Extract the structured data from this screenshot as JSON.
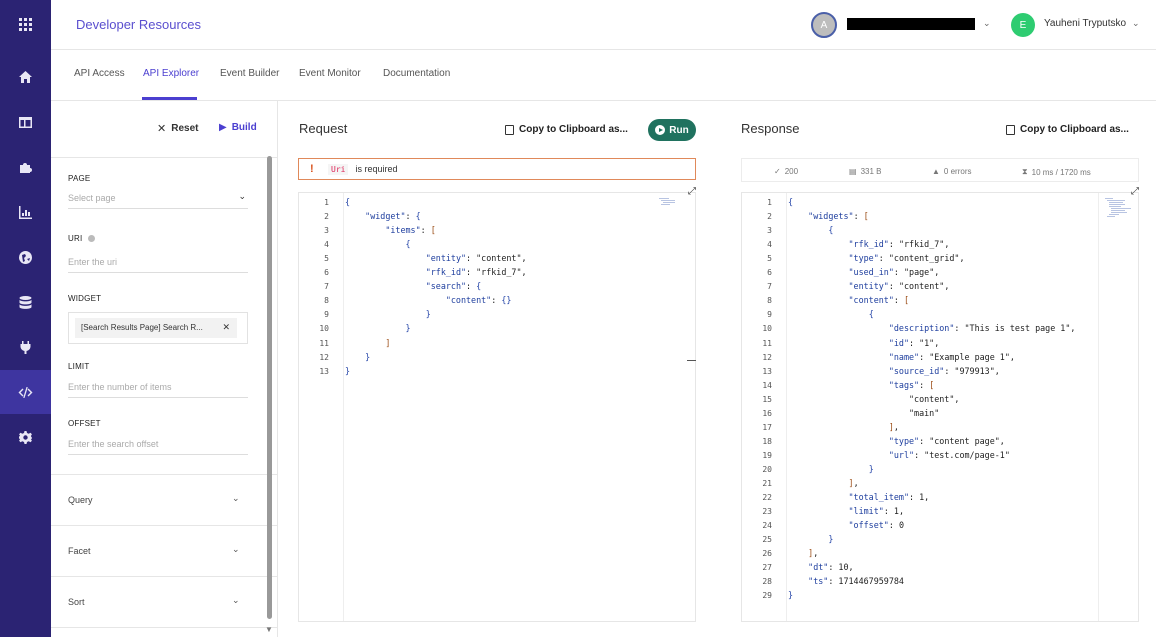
{
  "rail": [
    "apps-icon",
    "home-icon",
    "layout-icon",
    "puzzle-icon",
    "chart-icon",
    "globe-icon",
    "database-icon",
    "plug-icon",
    "code-icon",
    "gear-icon"
  ],
  "header": {
    "title": "Developer Resources",
    "avatar_a": "A",
    "avatar_e": "E",
    "user_name": "Yauheni Tryputsko"
  },
  "tabs": [
    "API Access",
    "API Explorer",
    "Event Builder",
    "Event Monitor",
    "Documentation"
  ],
  "panel": {
    "reset": "Reset",
    "build": "Build",
    "page_label": "PAGE",
    "page_placeholder": "Select page",
    "uri_label": "URI",
    "uri_placeholder": "Enter the uri",
    "widget_label": "WIDGET",
    "widget_chip": "[Search Results Page] Search R...",
    "limit_label": "LIMIT",
    "limit_placeholder": "Enter the number of items",
    "offset_label": "OFFSET",
    "offset_placeholder": "Enter the search offset",
    "sections": [
      "Query",
      "Facet",
      "Sort"
    ]
  },
  "request": {
    "title": "Request",
    "copy": "Copy to Clipboard as...",
    "run": "Run",
    "error_code": "Uri",
    "error_text": "is required",
    "lines": [
      "{",
      "    \"widget\": {",
      "        \"items\": [",
      "            {",
      "                \"entity\": \"content\",",
      "                \"rfk_id\": \"rfkid_7\",",
      "                \"search\": {",
      "                    \"content\": {}",
      "                }",
      "            }",
      "        ]",
      "    }",
      "}"
    ]
  },
  "response": {
    "title": "Response",
    "copy": "Copy to Clipboard as...",
    "status": "200",
    "size": "331 B",
    "errors": "0 errors",
    "timing": "10 ms / 1720 ms",
    "lines": [
      "{",
      "    \"widgets\": [",
      "        {",
      "            \"rfk_id\": \"rfkid_7\",",
      "            \"type\": \"content_grid\",",
      "            \"used_in\": \"page\",",
      "            \"entity\": \"content\",",
      "            \"content\": [",
      "                {",
      "                    \"description\": \"This is test page 1\",",
      "                    \"id\": \"1\",",
      "                    \"name\": \"Example page 1\",",
      "                    \"source_id\": \"979913\",",
      "                    \"tags\": [",
      "                        \"content\",",
      "                        \"main\"",
      "                    ],",
      "                    \"type\": \"content page\",",
      "                    \"url\": \"test.com/page-1\"",
      "                }",
      "            ],",
      "            \"total_item\": 1,",
      "            \"limit\": 1,",
      "            \"offset\": 0",
      "        }",
      "    ],",
      "    \"dt\": 10,",
      "    \"ts\": 1714467959784",
      "}"
    ]
  }
}
